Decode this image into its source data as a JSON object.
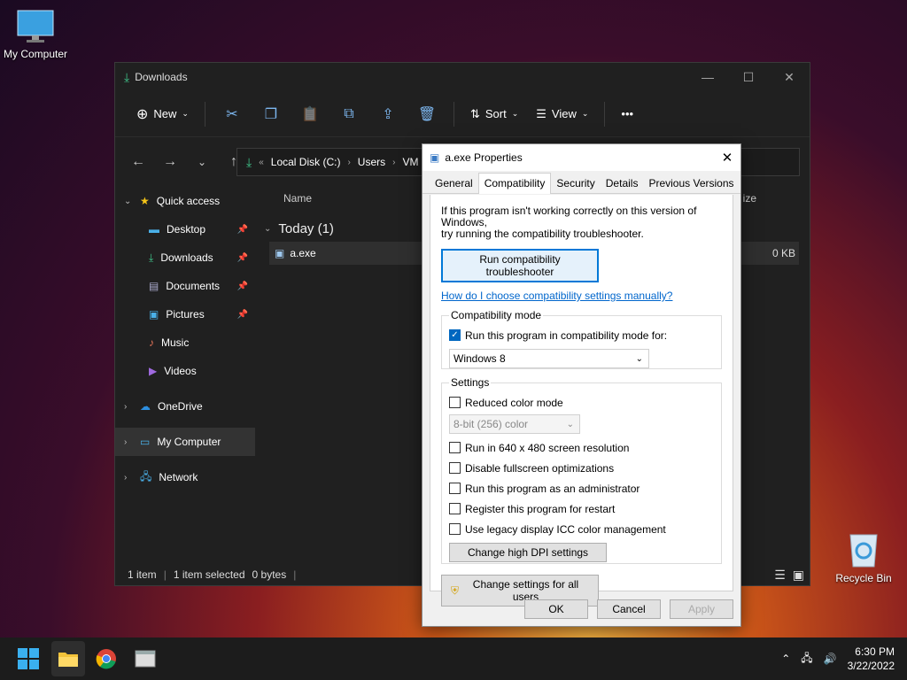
{
  "desktop": {
    "my_computer": "My Computer",
    "recycle_bin": "Recycle Bin"
  },
  "explorer": {
    "title": "Downloads",
    "toolbar": {
      "new": "New",
      "sort": "Sort",
      "view": "View",
      "more": "•••"
    },
    "address": [
      "Local Disk (C:)",
      "Users",
      "VM"
    ],
    "sidebar": {
      "quick_access": "Quick access",
      "desktop": "Desktop",
      "downloads": "Downloads",
      "documents": "Documents",
      "pictures": "Pictures",
      "music": "Music",
      "videos": "Videos",
      "onedrive": "OneDrive",
      "my_computer": "My Computer",
      "network": "Network"
    },
    "columns": {
      "name": "Name",
      "size": "ize"
    },
    "group": "Today (1)",
    "file": {
      "name": "a.exe",
      "size": "0 KB"
    },
    "status": {
      "items": "1 item",
      "selected": "1 item selected",
      "bytes": "0 bytes"
    }
  },
  "dialog": {
    "title": "a.exe Properties",
    "tabs": [
      "General",
      "Compatibility",
      "Security",
      "Details",
      "Previous Versions"
    ],
    "intro_line1": "If this program isn't working correctly on this version of Windows,",
    "intro_line2": "try running the compatibility troubleshooter.",
    "troubleshooter_btn": "Run compatibility troubleshooter",
    "help_link": "How do I choose compatibility settings manually?",
    "compat_mode": {
      "legend": "Compatibility mode",
      "checkbox": "Run this program in compatibility mode for:",
      "checked": true,
      "os_value": "Windows 8"
    },
    "settings": {
      "legend": "Settings",
      "reduced_color": "Reduced color mode",
      "color_value": "8-bit (256) color",
      "res_640": "Run in 640 x 480 screen resolution",
      "disable_fullscreen": "Disable fullscreen optimizations",
      "admin": "Run this program as an administrator",
      "restart": "Register this program for restart",
      "icc": "Use legacy display ICC color management",
      "dpi_btn": "Change high DPI settings"
    },
    "all_users_btn": "Change settings for all users",
    "ok": "OK",
    "cancel": "Cancel",
    "apply": "Apply"
  },
  "taskbar": {
    "time": "6:30 PM",
    "date": "3/22/2022"
  }
}
